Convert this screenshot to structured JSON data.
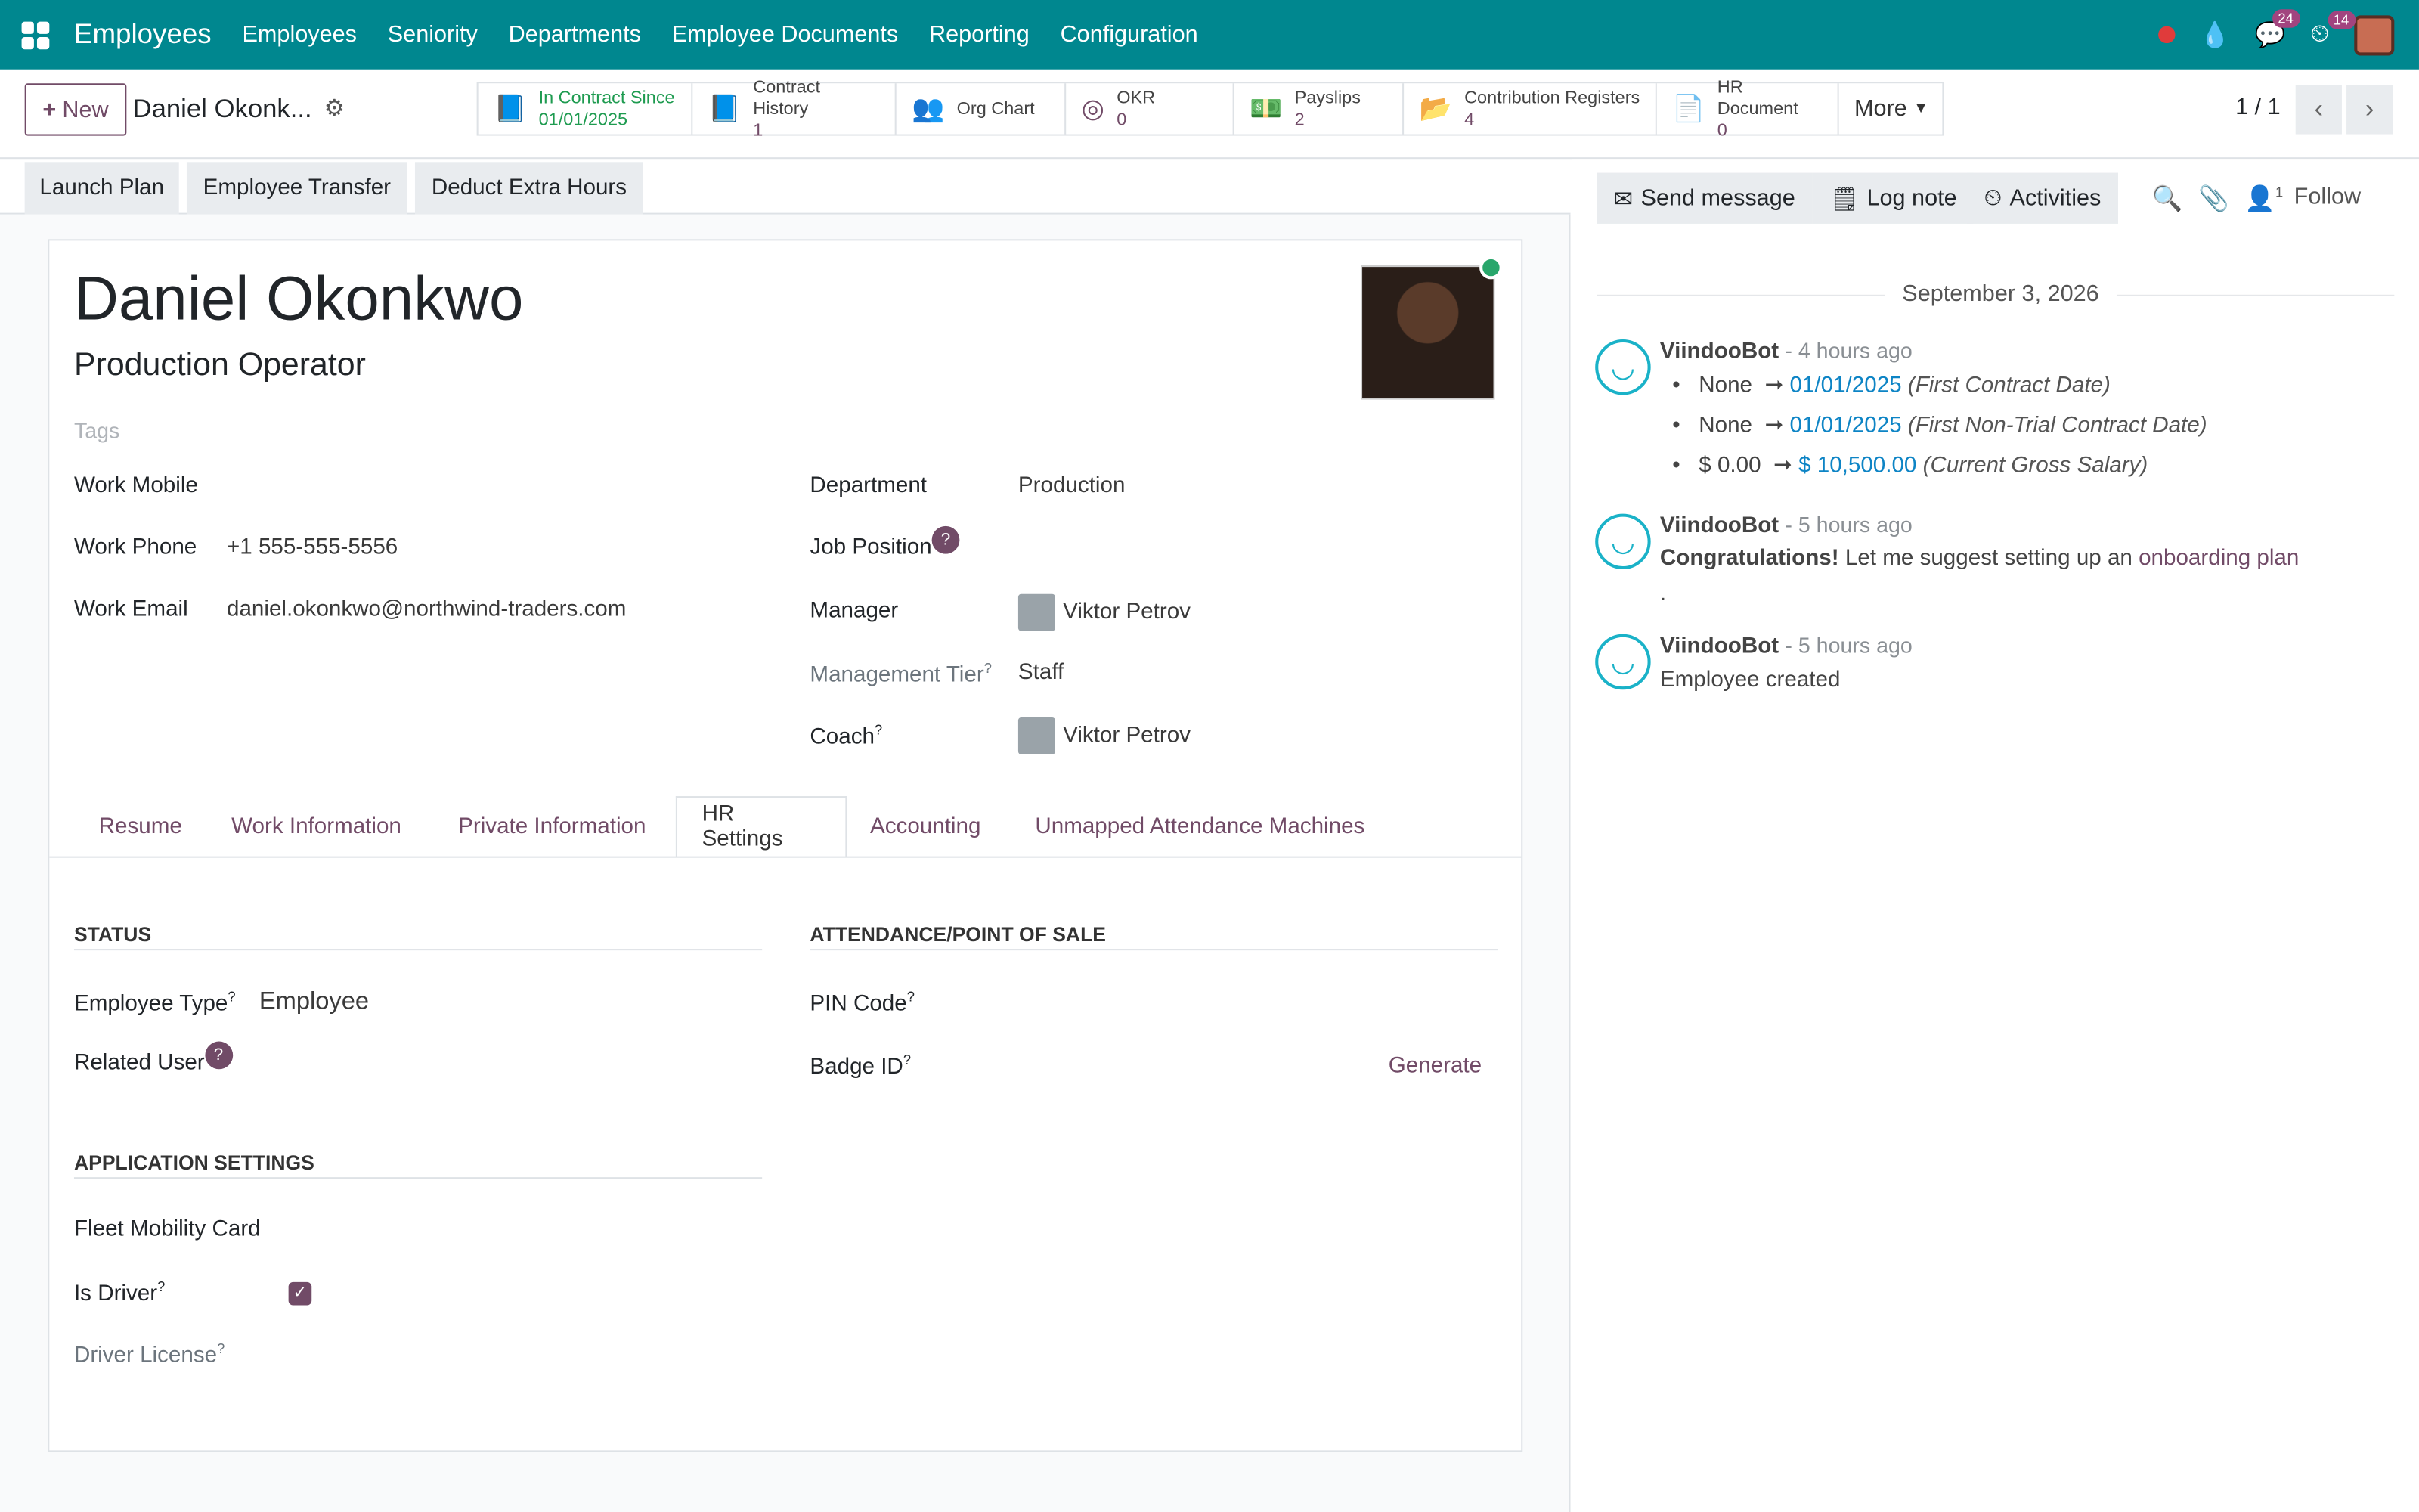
{
  "navbar": {
    "app": "Employees",
    "menus": [
      "Employees",
      "Seniority",
      "Departments",
      "Employee Documents",
      "Reporting",
      "Configuration"
    ],
    "messages_badge": "24",
    "activities_badge": "14"
  },
  "control": {
    "new": "New",
    "breadcrumb": "Daniel Okonk...",
    "pager": "1 / 1"
  },
  "smart_buttons": [
    {
      "label": "In Contract Since",
      "value": "01/01/2025",
      "icon": "book-icon"
    },
    {
      "label": "Contract History",
      "value": "1",
      "icon": "book-icon"
    },
    {
      "label": "Org Chart",
      "value": "",
      "icon": "users-icon"
    },
    {
      "label": "OKR",
      "value": "0",
      "icon": "target-icon"
    },
    {
      "label": "Payslips",
      "value": "2",
      "icon": "money-icon"
    },
    {
      "label": "Contribution Registers",
      "value": "4",
      "icon": "folder-icon"
    },
    {
      "label": "HR Document",
      "value": "0",
      "icon": "file-icon"
    },
    {
      "label": "More",
      "value": "",
      "icon": "caret-down-icon"
    }
  ],
  "status_buttons": [
    "Launch Plan",
    "Employee Transfer",
    "Deduct Extra Hours"
  ],
  "employee": {
    "name": "Daniel Okonkwo",
    "job_title": "Production Operator",
    "tags_placeholder": "Tags"
  },
  "fields_left": [
    {
      "label": "Work Mobile",
      "value": ""
    },
    {
      "label": "Work Phone",
      "value": "+1 555-555-5556"
    },
    {
      "label": "Work Email",
      "value": "daniel.okonkwo@northwind-traders.com"
    }
  ],
  "fields_right": [
    {
      "label": "Department",
      "value": "Production"
    },
    {
      "label": "Job Position",
      "value": ""
    },
    {
      "label": "Manager",
      "value": "Viktor Petrov"
    },
    {
      "label": "Management Tier",
      "value": "Staff"
    },
    {
      "label": "Coach",
      "value": "Viktor Petrov"
    }
  ],
  "tabs": [
    "Resume",
    "Work Information",
    "Private Information",
    "HR Settings",
    "Accounting",
    "Unmapped Attendance Machines"
  ],
  "hr": {
    "status_title": "STATUS",
    "employee_type_label": "Employee Type",
    "employee_type": "Employee",
    "related_user_label": "Related User",
    "app_title": "APPLICATION SETTINGS",
    "fleet_label": "Fleet Mobility Card",
    "driver_label": "Is Driver",
    "license_label": "Driver License",
    "att_title": "ATTENDANCE/POINT OF SALE",
    "pin_label": "PIN Code",
    "badge_label": "Badge ID",
    "generate": "Generate"
  },
  "chatter": {
    "send": "Send message",
    "log": "Log note",
    "activities": "Activities",
    "followers_count": "1",
    "follow": "Follow",
    "date": "September 3, 2026",
    "messages": [
      {
        "author": "ViindooBot",
        "time": "- 4 hours ago",
        "changes": [
          {
            "old": "None",
            "new": "01/01/2025",
            "field": "(First Contract Date)"
          },
          {
            "old": "None",
            "new": "01/01/2025",
            "field": "(First Non-Trial Contract Date)"
          },
          {
            "old": "$ 0.00",
            "new": "$ 10,500.00",
            "field": "(Current Gross Salary)"
          }
        ]
      },
      {
        "author": "ViindooBot",
        "time": "- 5 hours ago",
        "bold": "Congratulations!",
        "text": " Let me suggest setting up an ",
        "link": "onboarding plan",
        "tail": "."
      },
      {
        "author": "ViindooBot",
        "time": "- 5 hours ago",
        "text": "Employee created"
      }
    ]
  }
}
